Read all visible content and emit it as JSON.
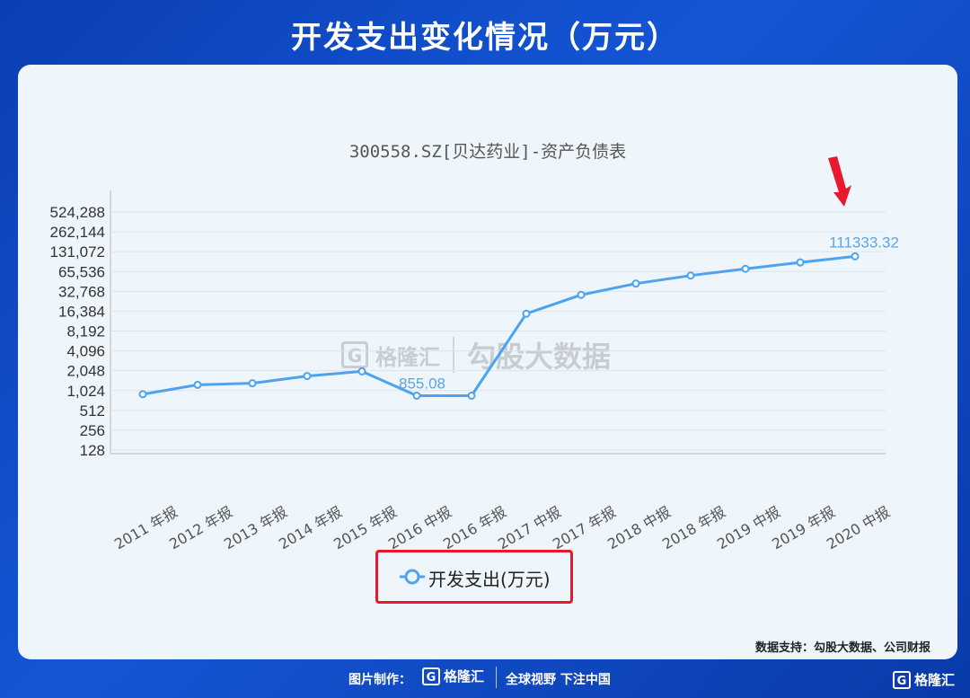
{
  "header": {
    "title": "开发支出变化情况（万元）"
  },
  "chart_data": {
    "type": "line",
    "title": "300558.SZ[贝达药业]-资产负债表",
    "yscale": "log2",
    "ylim": [
      128,
      524288
    ],
    "yticks": [
      "524,288",
      "262,144",
      "131,072",
      "65,536",
      "32,768",
      "16,384",
      "8,192",
      "4,096",
      "2,048",
      "1,024",
      "512",
      "256",
      "128"
    ],
    "ytick_values": [
      524288,
      262144,
      131072,
      65536,
      32768,
      16384,
      8192,
      4096,
      2048,
      1024,
      512,
      256,
      128
    ],
    "categories": [
      "2011 年报",
      "2012 年报",
      "2013 年报",
      "2014 年报",
      "2015 年报",
      "2016 中报",
      "2016 年报",
      "2017 中报",
      "2017 年报",
      "2018 中报",
      "2018 年报",
      "2019 中报",
      "2019 年报",
      "2020 中报"
    ],
    "series": [
      {
        "name": "开发支出(万元)",
        "color": "#4da3f0",
        "values": [
          900,
          1250,
          1320,
          1700,
          2000,
          855.08,
          855.08,
          15000,
          29000,
          43000,
          57000,
          72000,
          90000,
          111333.32
        ]
      }
    ],
    "annotations": [
      {
        "index": 5,
        "text": "855.08"
      },
      {
        "index": 13,
        "text": "111333.32"
      }
    ],
    "legend": "bottom-center",
    "grid": true
  },
  "legend": {
    "label": "开发支出(万元)"
  },
  "source": {
    "text": "数据支持：勾股大数据、公司财报"
  },
  "watermark": {
    "logo": "G",
    "name": "格隆汇",
    "text": "勾股大数据"
  },
  "footer": {
    "label": "图片制作：",
    "logo": "G",
    "brand": "格隆汇",
    "slogan": "全球视野 下注中国"
  },
  "corner": {
    "logo": "G",
    "brand": "格隆汇"
  },
  "colors": {
    "accent": "#4da3f0",
    "highlight": "#e8192c",
    "background": "#1456d6"
  }
}
